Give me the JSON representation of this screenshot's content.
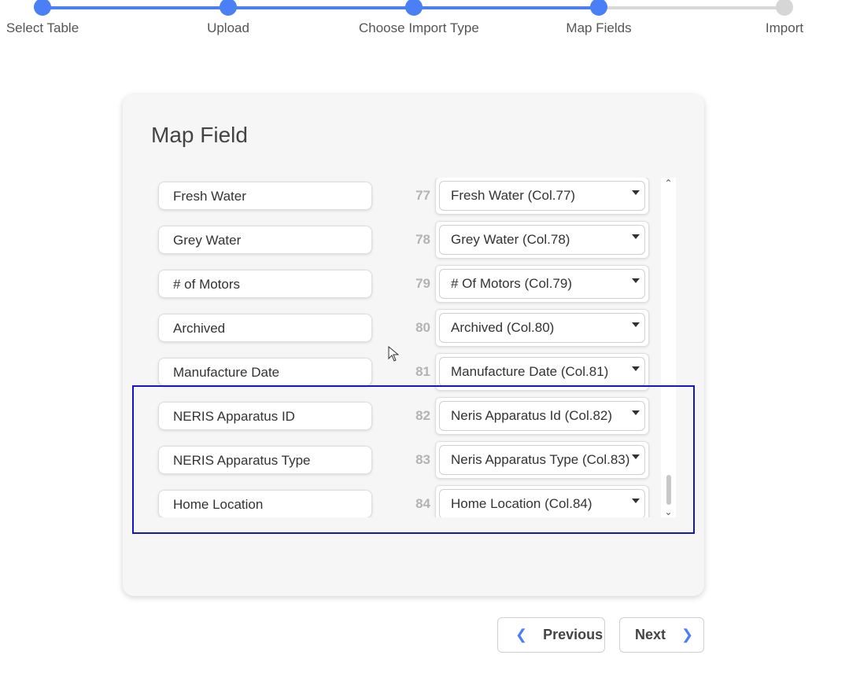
{
  "stepper": {
    "steps": [
      {
        "label": "Select Table",
        "state": "done"
      },
      {
        "label": "Upload",
        "state": "done"
      },
      {
        "label": "Choose Import Type",
        "state": "done"
      },
      {
        "label": "Map Fields",
        "state": "current"
      },
      {
        "label": "Import",
        "state": "todo"
      }
    ],
    "active_color": "#4a7ff5",
    "inactive_color": "#d6d6d6"
  },
  "card": {
    "title": "Map Field",
    "rows": [
      {
        "field": "Fresh Water",
        "col": "77",
        "mapping": "Fresh Water (Col.77)"
      },
      {
        "field": "Grey Water",
        "col": "78",
        "mapping": "Grey Water (Col.78)"
      },
      {
        "field": "# of Motors",
        "col": "79",
        "mapping": "# Of Motors (Col.79)"
      },
      {
        "field": "Archived",
        "col": "80",
        "mapping": "Archived (Col.80)"
      },
      {
        "field": "Manufacture Date",
        "col": "81",
        "mapping": "Manufacture Date (Col.81)"
      },
      {
        "field": "NERIS Apparatus ID",
        "col": "82",
        "mapping": "Neris Apparatus Id (Col.82)"
      },
      {
        "field": "NERIS Apparatus Type",
        "col": "83",
        "mapping": "Neris Apparatus Type (Col.83)"
      },
      {
        "field": "Home Location",
        "col": "84",
        "mapping": "Home Location (Col.84)"
      }
    ]
  },
  "buttons": {
    "previous": "Previous",
    "next": "Next"
  },
  "highlight_color": "#1414c8"
}
